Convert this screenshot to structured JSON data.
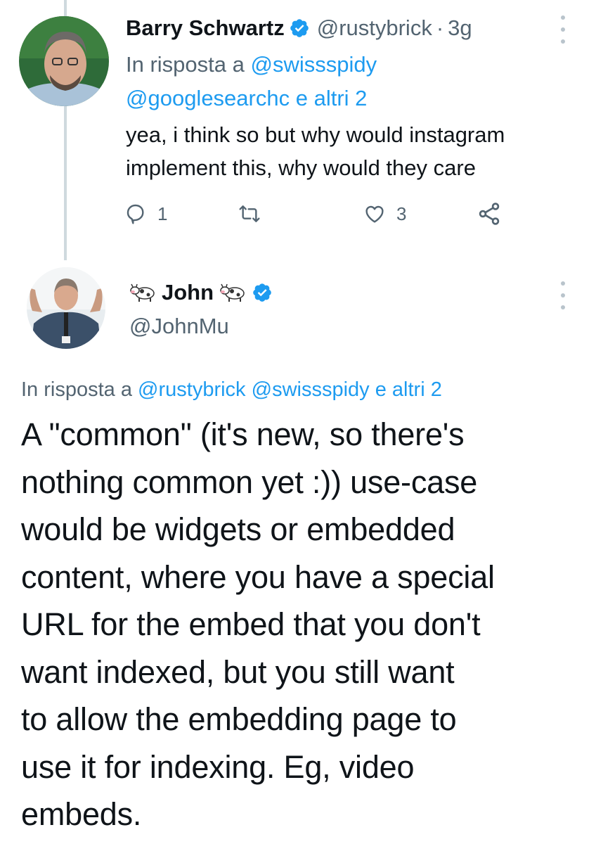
{
  "tweet1": {
    "author_name": "Barry Schwartz",
    "handle": "@rustybrick",
    "separator": "·",
    "time": "3g",
    "reply_prefix": "In risposta a",
    "reply_mention_1": "@swissspidy",
    "reply_mention_2": "@googlesearchc",
    "reply_suffix": "e altri 2",
    "text": "yea, i think so but why would instagram implement this, why would they care",
    "reply_count": "1",
    "like_count": "3"
  },
  "tweet2": {
    "author_name": "John",
    "handle": "@JohnMu",
    "reply_prefix": "In risposta a",
    "reply_mention_1": "@rustybrick",
    "reply_mention_2": "@swissspidy",
    "reply_suffix": "e altri 2",
    "text_lines": [
      "A \"common\" (it's new, so there's",
      "nothing common yet :)) use-case",
      "would be widgets or embedded",
      "content, where you have a special",
      "URL for the embed that you don't",
      "want indexed, but you still want",
      "to allow the embedding page to",
      "use it for indexing. Eg, video",
      "embeds."
    ]
  },
  "colors": {
    "link": "#1d9bf0",
    "secondary_text": "#536471",
    "primary_text": "#0f1419",
    "thread_line": "#cfd9de"
  },
  "icons": [
    "verified-badge-icon",
    "more-options-icon",
    "reply-icon",
    "retweet-icon",
    "like-icon",
    "share-icon",
    "cow-emoji-icon"
  ]
}
